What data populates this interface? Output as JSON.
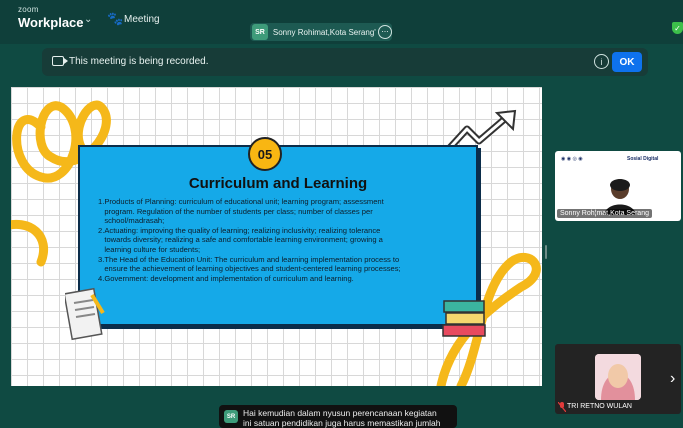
{
  "app": {
    "logo_small": "zoom",
    "logo_big": "Workplace",
    "menu_chevron": "⌄",
    "meeting_label": "Meeting"
  },
  "speaker": {
    "initials": "SR",
    "name": "Sonny Rohimat,Kota Serang's sc",
    "more_icon": "ellipsis-icon"
  },
  "banner": {
    "text": "This meeting is being recorded.",
    "info_icon": "ⓘ",
    "ok_label": "OK"
  },
  "slide": {
    "badge": "05",
    "title": "Curriculum and Learning",
    "items": [
      "1.Products of Planning: curriculum of educational unit; learning program; assessment",
      "   program. Regulation of the number of students per class; number of classes per",
      "   school/madrasah;",
      "2.Actuating: improving the quality of learning; realizing inclusivity; realizing tolerance",
      "   towards diversity; realizing a safe and comfortable learning environment; growing a",
      "   learning culture for students;",
      "3.The Head of the Education Unit: The curriculum and learning implementation process to",
      "   ensure the achievement of learning objectives and student-centered learning processes;",
      "4.Government: development and implementation of curriculum and learning."
    ]
  },
  "participants": [
    {
      "name": "Sonny Roh¦mat,Kota Serang",
      "header": "Sosial Digital"
    },
    {
      "name": "TRI RETNO WULAN"
    }
  ],
  "caption": {
    "initials": "SR",
    "line1": "Hai kemudian dalam nyusun perencanaan kegiatan",
    "line2": "ini satuan pendidikan juga harus memastikan jumlah"
  },
  "colors": {
    "accent": "#0e72ed",
    "slide_card": "#15a9e8",
    "badge": "#f9b612",
    "decor": "#f5b81a"
  }
}
